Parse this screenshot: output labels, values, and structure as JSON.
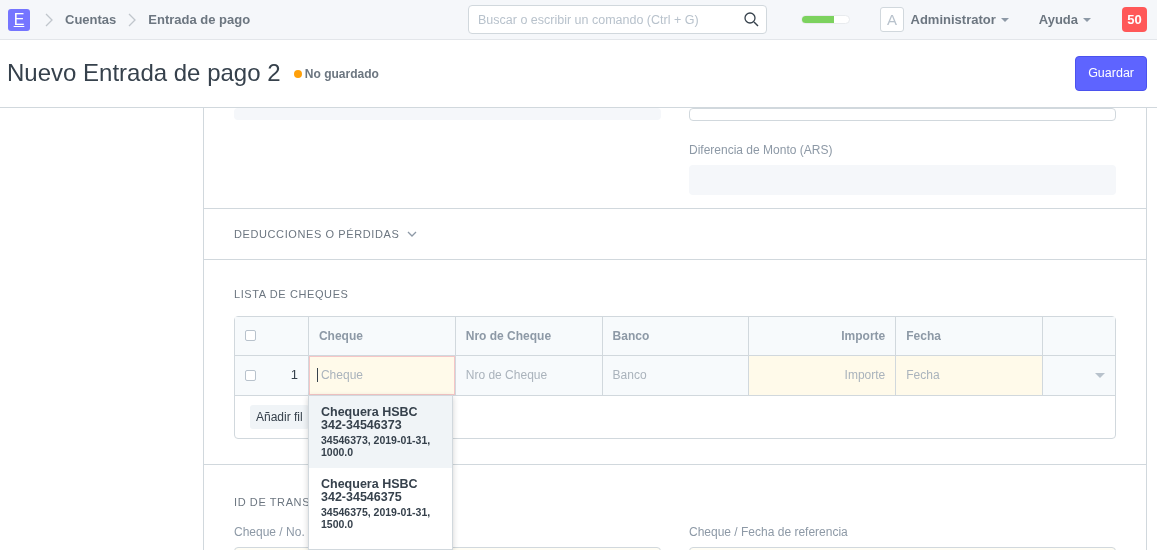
{
  "navbar": {
    "logo": "E",
    "breadcrumbs": [
      "Cuentas",
      "Entrada de pago"
    ],
    "search": {
      "placeholder": "Buscar o escribir un comando (Ctrl + G)"
    },
    "progress": {
      "level": 0.68
    },
    "avatar": "A",
    "user_menu": "Administrator",
    "help_menu": "Ayuda",
    "notifications": "50"
  },
  "header": {
    "title": "Nuevo Entrada de pago 2",
    "status": "No guardado",
    "primary_button": "Guardar"
  },
  "sections": [
    {
      "kind": "fields",
      "fields": [
        {
          "label": "Diferencia de Monto (ARS)"
        }
      ]
    },
    {
      "kind": "collapsed",
      "title": "DEDUCCIONES O PÉRDIDAS",
      "expanded": false
    },
    {
      "kind": "grid",
      "title": "LISTA DE CHEQUES",
      "header_checked": false,
      "columns": [
        {
          "label": "Cheque",
          "kind": "text"
        },
        {
          "label": "Nro de Cheque",
          "kind": "text"
        },
        {
          "label": "Banco",
          "kind": "text"
        },
        {
          "label": "Importe",
          "kind": "number"
        },
        {
          "label": "Fecha",
          "kind": "text"
        }
      ],
      "rows": [
        {
          "index": "1",
          "checked": false,
          "cells": [
            {
              "placeholder": "Cheque",
              "focused": true,
              "required": true
            },
            {
              "placeholder": "Nro de Cheque",
              "focused": false,
              "required": false
            },
            {
              "placeholder": "Banco",
              "focused": false,
              "required": false
            },
            {
              "placeholder": "Importe",
              "focused": false,
              "required": true
            },
            {
              "placeholder": "Fecha",
              "focused": false,
              "required": true
            }
          ]
        }
      ],
      "add_row": "Añadir fil",
      "dropdown": [
        {
          "title": "Chequera HSBC 342-34546373",
          "detail": "34546373, 2019-01-31, 1000.0",
          "selected": true
        },
        {
          "title": "Chequera HSBC 342-34546375",
          "detail": "34546375, 2019-01-31, 1500.0",
          "selected": false
        }
      ]
    },
    {
      "kind": "reference",
      "title": "ID DE TRANS",
      "fields": [
        {
          "label": "Cheque / No."
        },
        {
          "label": "Cheque / Fecha de referencia"
        }
      ]
    }
  ]
}
